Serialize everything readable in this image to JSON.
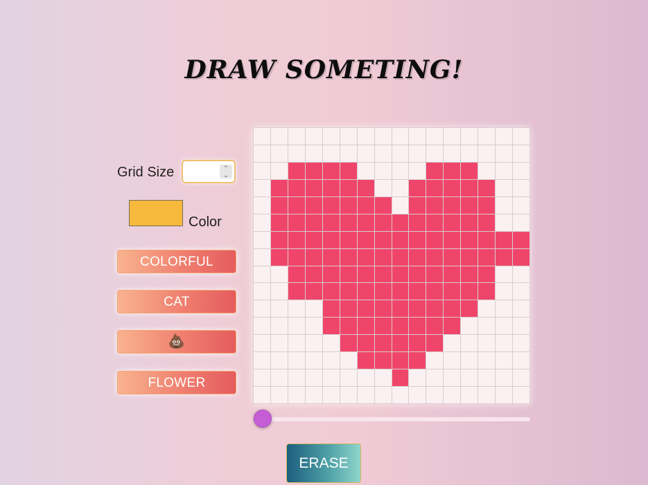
{
  "page": {
    "title": "DRAW SOMETING!"
  },
  "controls": {
    "grid_size_label": "Grid Size",
    "grid_size_value": "",
    "color_label": "Color",
    "color_value": "#f6b93b"
  },
  "presets": {
    "colorful_label": "COLORFUL",
    "cat_label": "CAT",
    "poop_label": "💩",
    "flower_label": "FLOWER"
  },
  "canvas": {
    "columns": 16,
    "rows": 16,
    "empty_color": "#fbf1f3",
    "fill_color": "#f0456b",
    "pixels": [
      "0000000000000000",
      "0000000000000000",
      "0011110000111000",
      "0111111001111100",
      "0111111101111100",
      "0111111111111100",
      "0111111111111111",
      "0111111111111111",
      "0011111111111100",
      "0011111111111100",
      "0000111111111000",
      "0000111111110000",
      "0000011111100000",
      "0000001111000000",
      "0000000010000000",
      "0000000000000000"
    ]
  },
  "slider": {
    "value_fraction": 0.0,
    "thumb_color": "#c55ed6"
  },
  "erase": {
    "label": "ERASE"
  }
}
